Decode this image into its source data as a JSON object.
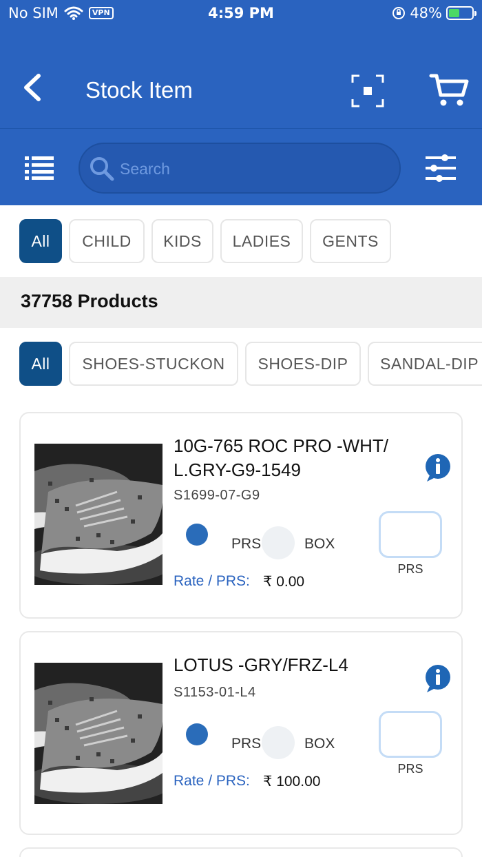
{
  "status_bar": {
    "carrier": "No SIM",
    "vpn": "VPN",
    "time": "4:59 PM",
    "battery_percent": "48%",
    "battery_level": 0.48
  },
  "header": {
    "title": "Stock Item"
  },
  "search": {
    "placeholder": "Search",
    "value": ""
  },
  "category_chips": [
    "All",
    "CHILD",
    "KIDS",
    "LADIES",
    "GENTS"
  ],
  "product_count": "37758 Products",
  "type_chips": [
    "All",
    "SHOES-STUCKON",
    "SHOES-DIP",
    "SANDAL-DIP"
  ],
  "products": [
    {
      "name_line1": "10G-765 ROC PRO -WHT/",
      "name_line2": "L.GRY-G9-1549",
      "code": "S1699-07-G9",
      "unit_1": "PRS",
      "unit_2": "BOX",
      "qty_unit": "PRS",
      "rate_label": "Rate / PRS:",
      "rate": "₹ 0.00"
    },
    {
      "name_line1": "LOTUS -GRY/FRZ-L4",
      "name_line2": "",
      "code": "S1153-01-L4",
      "unit_1": "PRS",
      "unit_2": "BOX",
      "qty_unit": "PRS",
      "rate_label": "Rate / PRS:",
      "rate": "₹ 100.00"
    }
  ],
  "colors": {
    "primary": "#2a63bf",
    "chip_active": "#0f4f87",
    "battery": "#4cd964"
  },
  "icons": {
    "back": "chevron-left-icon",
    "scan": "scan-icon",
    "cart": "cart-icon",
    "list": "list-icon",
    "search": "search-icon",
    "filter": "sliders-icon",
    "info": "info-icon"
  }
}
